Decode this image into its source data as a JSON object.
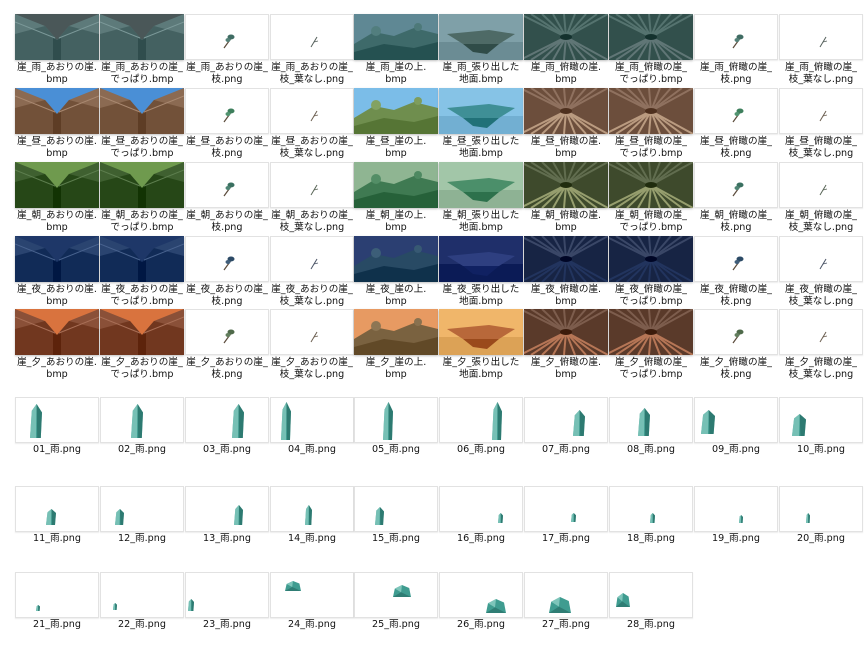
{
  "scenery_rows": [
    {
      "row": "雨",
      "items": [
        {
          "label": "崖_雨_あおりの崖.\nbmp",
          "kind": "low",
          "sky": "#4a5758",
          "ground": "#5d7a7a",
          "icon": "cliff-low-angle-thumbnail"
        },
        {
          "label": "崖_雨_あおりの崖_\nでっぱり.bmp",
          "kind": "low",
          "sky": "#4a5758",
          "ground": "#5d7a7a",
          "icon": "cliff-low-angle-ledge-thumbnail"
        },
        {
          "label": "崖_雨_あおりの崖_\n枝.png",
          "kind": "branch",
          "leaf": "#3f6c63",
          "icon": "branch-thumbnail"
        },
        {
          "label": "崖_雨_あおりの崖_\n枝_葉なし.png",
          "kind": "twig",
          "leaf": "#55605c",
          "icon": "bare-branch-thumbnail"
        },
        {
          "label": "崖_雨_崖の上.\nbmp",
          "kind": "top",
          "sky": "#5f8894",
          "ground": "#3e6a6a",
          "icon": "clifftop-thumbnail"
        },
        {
          "label": "崖_雨_張り出した\n地面.bmp",
          "kind": "plat",
          "sky": "#7fa0a8",
          "ground": "#4e6a66",
          "icon": "overhang-ground-thumbnail"
        },
        {
          "label": "崖_雨_俯瞰の崖.\nbmp",
          "kind": "down",
          "sky": "#6a8080",
          "ground": "#32504c",
          "icon": "cliff-overhead-thumbnail"
        },
        {
          "label": "崖_雨_俯瞰の崖_\nでっぱり.bmp",
          "kind": "down",
          "sky": "#6a8080",
          "ground": "#32504c",
          "icon": "cliff-overhead-ledge-thumbnail"
        },
        {
          "label": "崖_雨_俯瞰の崖_\n枝.png",
          "kind": "branch",
          "leaf": "#3f6c63",
          "icon": "branch-thumbnail"
        },
        {
          "label": "崖_雨_俯瞰の崖_\n枝_葉なし.png",
          "kind": "twig",
          "leaf": "#55605c",
          "icon": "bare-branch-thumbnail"
        }
      ]
    },
    {
      "row": "昼",
      "items": [
        {
          "label": "崖_昼_あおりの崖.\nbmp",
          "kind": "low",
          "sky": "#4a8fd6",
          "ground": "#8b6a52",
          "icon": "cliff-low-angle-thumbnail"
        },
        {
          "label": "崖_昼_あおりの崖_\nでっぱり.bmp",
          "kind": "low",
          "sky": "#4a8fd6",
          "ground": "#8b6a52",
          "icon": "cliff-low-angle-ledge-thumbnail"
        },
        {
          "label": "崖_昼_あおりの崖_\n枝.png",
          "kind": "branch",
          "leaf": "#3d7f5c",
          "icon": "branch-thumbnail"
        },
        {
          "label": "崖_昼_あおりの崖_\n枝_葉なし.png",
          "kind": "twig",
          "leaf": "#6b5e50",
          "icon": "bare-branch-thumbnail"
        },
        {
          "label": "崖_昼_崖の上.\nbmp",
          "kind": "top",
          "sky": "#7bbde8",
          "ground": "#6f8e4e",
          "icon": "clifftop-thumbnail"
        },
        {
          "label": "崖_昼_張り出した\n地面.bmp",
          "kind": "plat",
          "sky": "#86c3e6",
          "ground": "#3f8f96",
          "icon": "overhang-ground-thumbnail"
        },
        {
          "label": "崖_昼_俯瞰の崖.\nbmp",
          "kind": "down",
          "sky": "#c4a58a",
          "ground": "#6c4e3c",
          "icon": "cliff-overhead-thumbnail"
        },
        {
          "label": "崖_昼_俯瞰の崖_\nでっぱり.bmp",
          "kind": "down",
          "sky": "#c4a58a",
          "ground": "#6c4e3c",
          "icon": "cliff-overhead-ledge-thumbnail"
        },
        {
          "label": "崖_昼_俯瞰の崖_\n枝.png",
          "kind": "branch",
          "leaf": "#3d7f5c",
          "icon": "branch-thumbnail"
        },
        {
          "label": "崖_昼_俯瞰の崖_\n枝_葉なし.png",
          "kind": "twig",
          "leaf": "#6b5e50",
          "icon": "bare-branch-thumbnail"
        }
      ]
    },
    {
      "row": "朝",
      "items": [
        {
          "label": "崖_朝_あおりの崖.\nbmp",
          "kind": "low",
          "sky": "#6f9a4e",
          "ground": "#3f6030",
          "icon": "cliff-low-angle-thumbnail"
        },
        {
          "label": "崖_朝_あおりの崖_\nでっぱり.bmp",
          "kind": "low",
          "sky": "#6f9a4e",
          "ground": "#3f6030",
          "icon": "cliff-low-angle-ledge-thumbnail"
        },
        {
          "label": "崖_朝_あおりの崖_\n枝.png",
          "kind": "branch",
          "leaf": "#3a7060",
          "icon": "branch-thumbnail"
        },
        {
          "label": "崖_朝_あおりの崖_\n枝_葉なし.png",
          "kind": "twig",
          "leaf": "#5a6658",
          "icon": "bare-branch-thumbnail"
        },
        {
          "label": "崖_朝_崖の上.\nbmp",
          "kind": "top",
          "sky": "#8fb592",
          "ground": "#3f7a52",
          "icon": "clifftop-thumbnail"
        },
        {
          "label": "崖_朝_張り出した\n地面.bmp",
          "kind": "plat",
          "sky": "#a2c6a8",
          "ground": "#4b8f6a",
          "icon": "overhang-ground-thumbnail"
        },
        {
          "label": "崖_朝_俯瞰の崖.\nbmp",
          "kind": "down",
          "sky": "#a0a878",
          "ground": "#3e4a2c",
          "icon": "cliff-overhead-thumbnail"
        },
        {
          "label": "崖_朝_俯瞰の崖_\nでっぱり.bmp",
          "kind": "down",
          "sky": "#a0a878",
          "ground": "#3e4a2c",
          "icon": "cliff-overhead-ledge-thumbnail"
        },
        {
          "label": "崖_朝_俯瞰の崖_\n枝.png",
          "kind": "branch",
          "leaf": "#3a7060",
          "icon": "branch-thumbnail"
        },
        {
          "label": "崖_朝_俯瞰の崖_\n枝_葉なし.png",
          "kind": "twig",
          "leaf": "#5a6658",
          "icon": "bare-branch-thumbnail"
        }
      ]
    },
    {
      "row": "夜",
      "items": [
        {
          "label": "崖_夜_あおりの崖.\nbmp",
          "kind": "low",
          "sky": "#1e3768",
          "ground": "#2a4470",
          "icon": "cliff-low-angle-thumbnail"
        },
        {
          "label": "崖_夜_あおりの崖_\nでっぱり.bmp",
          "kind": "low",
          "sky": "#1e3768",
          "ground": "#2a4470",
          "icon": "cliff-low-angle-ledge-thumbnail"
        },
        {
          "label": "崖_夜_あおりの崖_\n枝.png",
          "kind": "branch",
          "leaf": "#2c4a66",
          "icon": "branch-thumbnail"
        },
        {
          "label": "崖_夜_あおりの崖_\n枝_葉なし.png",
          "kind": "twig",
          "leaf": "#4a5466",
          "icon": "bare-branch-thumbnail"
        },
        {
          "label": "崖_夜_崖の上.\nbmp",
          "kind": "top",
          "sky": "#2b3f72",
          "ground": "#284a64",
          "icon": "clifftop-thumbnail"
        },
        {
          "label": "崖_夜_張り出した\n地面.bmp",
          "kind": "plat",
          "sky": "#1f2f6a",
          "ground": "#2e3f80",
          "icon": "overhang-ground-thumbnail"
        },
        {
          "label": "崖_夜_俯瞰の崖.\nbmp",
          "kind": "down",
          "sky": "#2c3e68",
          "ground": "#172444",
          "icon": "cliff-overhead-thumbnail"
        },
        {
          "label": "崖_夜_俯瞰の崖_\nでっぱり.bmp",
          "kind": "down",
          "sky": "#2c3e68",
          "ground": "#172444",
          "icon": "cliff-overhead-ledge-thumbnail"
        },
        {
          "label": "崖_夜_俯瞰の崖_\n枝.png",
          "kind": "branch",
          "leaf": "#2c4a66",
          "icon": "branch-thumbnail"
        },
        {
          "label": "崖_夜_俯瞰の崖_\n枝_葉なし.png",
          "kind": "twig",
          "leaf": "#4a5466",
          "icon": "bare-branch-thumbnail"
        }
      ]
    },
    {
      "row": "夕",
      "items": [
        {
          "label": "崖_夕_あおりの崖.\nbmp",
          "kind": "low",
          "sky": "#d9733e",
          "ground": "#8a5038",
          "icon": "cliff-low-angle-thumbnail"
        },
        {
          "label": "崖_夕_あおりの崖_\nでっぱり.bmp",
          "kind": "low",
          "sky": "#d9733e",
          "ground": "#8a5038",
          "icon": "cliff-low-angle-ledge-thumbnail"
        },
        {
          "label": "崖_夕_あおりの崖_\n枝.png",
          "kind": "branch",
          "leaf": "#4f6a4a",
          "icon": "branch-thumbnail"
        },
        {
          "label": "崖_夕_あおりの崖_\n枝_葉なし.png",
          "kind": "twig",
          "leaf": "#6b5e50",
          "icon": "bare-branch-thumbnail"
        },
        {
          "label": "崖_夕_崖の上.\nbmp",
          "kind": "top",
          "sky": "#e79a62",
          "ground": "#7a6240",
          "icon": "clifftop-thumbnail"
        },
        {
          "label": "崖_夕_張り出した\n地面.bmp",
          "kind": "plat",
          "sky": "#f0b66a",
          "ground": "#b8683a",
          "icon": "overhang-ground-thumbnail"
        },
        {
          "label": "崖_夕_俯瞰の崖.\nbmp",
          "kind": "down",
          "sky": "#c08060",
          "ground": "#5a3a2a",
          "icon": "cliff-overhead-thumbnail"
        },
        {
          "label": "崖_夕_俯瞰の崖_\nでっぱり.bmp",
          "kind": "down",
          "sky": "#c08060",
          "ground": "#5a3a2a",
          "icon": "cliff-overhead-ledge-thumbnail"
        },
        {
          "label": "崖_夕_俯瞰の崖_\n枝.png",
          "kind": "branch",
          "leaf": "#4f6a4a",
          "icon": "branch-thumbnail"
        },
        {
          "label": "崖_夕_俯瞰の崖_\n枝_葉なし.png",
          "kind": "twig",
          "leaf": "#6b5e50",
          "icon": "bare-branch-thumbnail"
        }
      ]
    }
  ],
  "crystal_files": [
    {
      "label": "01_雨.png",
      "icon": "crystal-shard-thumbnail"
    },
    {
      "label": "02_雨.png",
      "icon": "crystal-shard-thumbnail"
    },
    {
      "label": "03_雨.png",
      "icon": "crystal-shard-thumbnail"
    },
    {
      "label": "04_雨.png",
      "icon": "crystal-shard-thumbnail"
    },
    {
      "label": "05_雨.png",
      "icon": "crystal-shard-thumbnail"
    },
    {
      "label": "06_雨.png",
      "icon": "crystal-shard-thumbnail"
    },
    {
      "label": "07_雨.png",
      "icon": "crystal-shard-thumbnail"
    },
    {
      "label": "08_雨.png",
      "icon": "crystal-shard-thumbnail"
    },
    {
      "label": "09_雨.png",
      "icon": "crystal-shard-thumbnail"
    },
    {
      "label": "10_雨.png",
      "icon": "crystal-shard-thumbnail"
    },
    {
      "label": "11_雨.png",
      "icon": "crystal-shard-thumbnail"
    },
    {
      "label": "12_雨.png",
      "icon": "crystal-shard-thumbnail"
    },
    {
      "label": "13_雨.png",
      "icon": "crystal-shard-thumbnail"
    },
    {
      "label": "14_雨.png",
      "icon": "crystal-shard-thumbnail"
    },
    {
      "label": "15_雨.png",
      "icon": "crystal-shard-thumbnail"
    },
    {
      "label": "16_雨.png",
      "icon": "crystal-shard-thumbnail"
    },
    {
      "label": "17_雨.png",
      "icon": "crystal-shard-thumbnail"
    },
    {
      "label": "18_雨.png",
      "icon": "crystal-shard-thumbnail"
    },
    {
      "label": "19_雨.png",
      "icon": "crystal-shard-thumbnail"
    },
    {
      "label": "20_雨.png",
      "icon": "crystal-shard-thumbnail"
    },
    {
      "label": "21_雨.png",
      "icon": "crystal-shard-thumbnail"
    },
    {
      "label": "22_雨.png",
      "icon": "crystal-shard-thumbnail"
    },
    {
      "label": "23_雨.png",
      "icon": "crystal-shard-thumbnail"
    },
    {
      "label": "24_雨.png",
      "icon": "crystal-rock-thumbnail"
    },
    {
      "label": "25_雨.png",
      "icon": "crystal-rock-thumbnail"
    },
    {
      "label": "26_雨.png",
      "icon": "crystal-rock-thumbnail"
    },
    {
      "label": "27_雨.png",
      "icon": "crystal-rock-thumbnail"
    },
    {
      "label": "28_雨.png",
      "icon": "crystal-rock-thumbnail"
    }
  ],
  "colors": {
    "crystal_light": "#8fd0c4",
    "crystal_mid": "#3f9c90",
    "crystal_dark": "#1f5e58",
    "label_text": "#111111"
  }
}
